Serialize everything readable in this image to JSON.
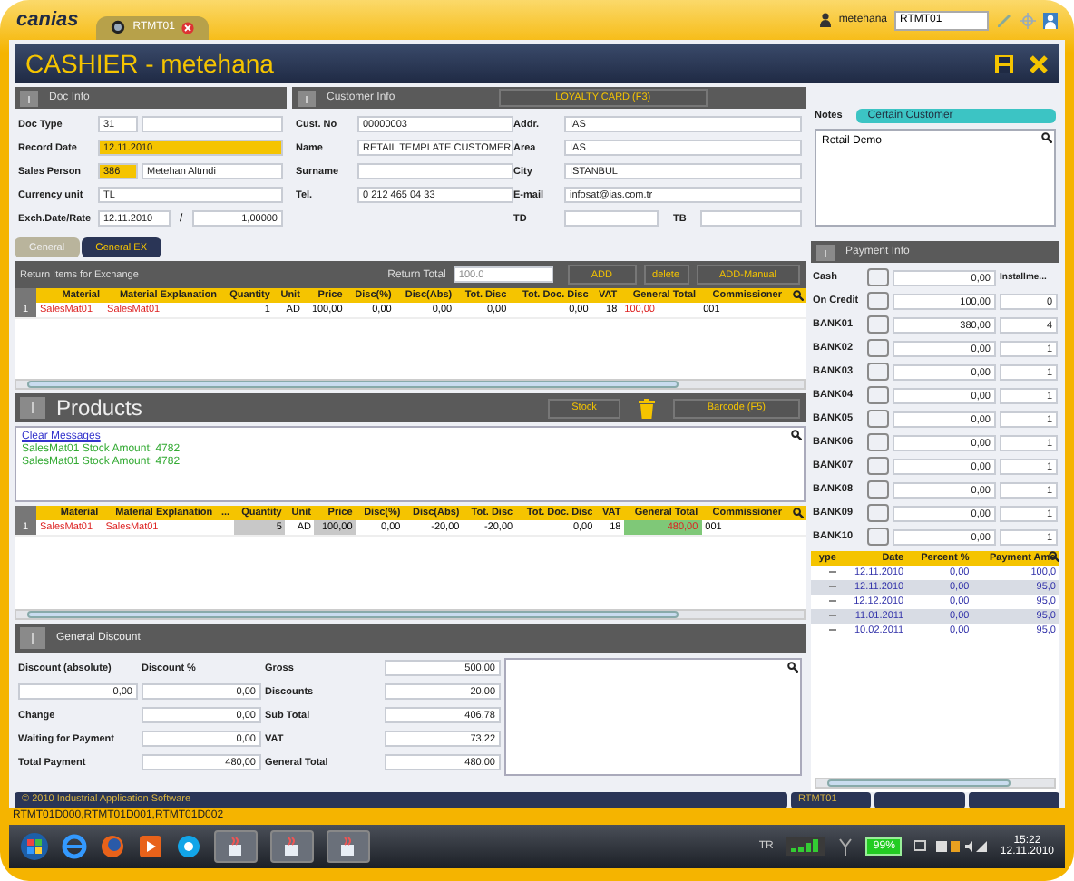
{
  "app": {
    "logo": "canias",
    "tab": {
      "label": "RTMT01"
    },
    "user": "metehana",
    "server": "RTMT01"
  },
  "window": {
    "title": "CASHIER - metehana"
  },
  "doc_info": {
    "title": "Doc Info",
    "fields": [
      {
        "label": "Doc Type",
        "inputs": [
          {
            "value": "31",
            "highlighted": false
          },
          {
            "highlighted": false
          }
        ]
      },
      {
        "label": "Record Date",
        "inputs": [
          {
            "value": "12.11.2010",
            "highlighted": true
          }
        ]
      },
      {
        "label": "Sales Person",
        "inputs": [
          {
            "value": "386",
            "highlighted": true
          },
          {
            "value": "Metehan Altındi",
            "highlighted": false
          }
        ]
      },
      {
        "label": "Currency unit",
        "inputs": [
          {
            "value": "TL",
            "highlighted": false
          }
        ]
      },
      {
        "label": "Exch.Date/Rate",
        "separator": "/",
        "inputs": [
          {
            "value": "12.11.2010",
            "highlighted": false
          },
          {
            "value": "1,00000",
            "highlighted": false
          }
        ]
      }
    ]
  },
  "customer_info": {
    "title": "Customer Info",
    "loyalty_button": "LOYALTY CARD (F3)",
    "left": [
      {
        "label": "Cust. No",
        "value": "00000003"
      },
      {
        "label": "Name",
        "value": "RETAIL TEMPLATE CUSTOMER"
      },
      {
        "label": "Surname"
      },
      {
        "label": "Tel.",
        "value": "0 212 465 04 33"
      }
    ],
    "right": [
      {
        "label": "Addr.",
        "value": "IAS"
      },
      {
        "label": "Area",
        "value": "IAS"
      },
      {
        "label": "City",
        "value": "ISTANBUL"
      },
      {
        "label": "E-mail",
        "value": "infosat@ias.com.tr"
      }
    ],
    "bottom": [
      {
        "label": "TD"
      },
      {
        "label": "TB"
      }
    ]
  },
  "notes": {
    "label": "Notes",
    "badge": "Certain Customer",
    "text": "Retail Demo"
  },
  "tabs": [
    {
      "label": "General",
      "selected": false
    },
    {
      "label": "General EX",
      "selected": true
    }
  ],
  "return_bar": {
    "title": "Return Items for Exchange",
    "total_label": "Return Total",
    "total_value": "100.0",
    "buttons": [
      "ADD",
      "delete",
      "ADD-Manual"
    ]
  },
  "return_table": {
    "columns": [
      "Material",
      "Material Explanation",
      "Quantity",
      "Unit",
      "Price",
      "Disc(%)",
      "Disc(Abs)",
      "Tot. Disc",
      "Tot. Doc. Disc",
      "VAT",
      "General Total",
      "Commissioner"
    ],
    "rows": [
      {
        "number": "1",
        "cells": [
          "SalesMat01",
          "SalesMat01",
          "1",
          "AD",
          "100,00",
          "0,00",
          "0,00",
          "0,00",
          "0,00",
          "18",
          "100,00",
          "001"
        ]
      }
    ]
  },
  "products": {
    "title": "Products",
    "stock_button": "Stock",
    "barcode_button": "Barcode (F5)"
  },
  "messages": {
    "link": "Clear Messages",
    "lines": [
      "SalesMat01 Stock Amount: 4782",
      "SalesMat01 Stock Amount: 4782"
    ]
  },
  "products_table": {
    "columns": [
      "Material",
      "Material Explanation",
      "...",
      "Quantity",
      "Unit",
      "Price",
      "Disc(%)",
      "Disc(Abs)",
      "Tot. Disc",
      "Tot. Doc. Disc",
      "VAT",
      "General Total",
      "Commissioner"
    ],
    "rows": [
      {
        "number": "1",
        "cells": [
          "SalesMat01",
          "SalesMat01",
          null,
          "5",
          "AD",
          "100,00",
          "0,00",
          "-20,00",
          "-20,00",
          "0,00",
          "18",
          "480,00",
          "001"
        ]
      }
    ]
  },
  "general_discount": {
    "title": "General Discount",
    "discount_labels": [
      "Discount (absolute)",
      "Discount %"
    ],
    "discount_values": [
      "0,00",
      "0,00"
    ],
    "left_rows": [
      {
        "label": "Change",
        "value": "0,00"
      },
      {
        "label": "Waiting for Payment",
        "value": "0,00"
      },
      {
        "label": "Total Payment",
        "value": "480,00"
      }
    ],
    "totals": [
      {
        "label": "Gross",
        "value": "500,00"
      },
      {
        "label": "Discounts",
        "value": "20,00"
      },
      {
        "label": "Sub Total",
        "value": "406,78"
      },
      {
        "label": "VAT",
        "value": "73,22"
      },
      {
        "label": "General Total",
        "value": "480,00"
      }
    ]
  },
  "payment_info": {
    "title": "Payment Info",
    "installments_heading": "Installme...",
    "methods": [
      {
        "label": "Cash",
        "amount": "0,00"
      },
      {
        "label": "On Credit",
        "amount": "100,00",
        "installments": "0"
      },
      {
        "label": "BANK01",
        "amount": "380,00",
        "installments": "4"
      },
      {
        "label": "BANK02",
        "amount": "0,00",
        "installments": "1"
      },
      {
        "label": "BANK03",
        "amount": "0,00",
        "installments": "1"
      },
      {
        "label": "BANK04",
        "amount": "0,00",
        "installments": "1"
      },
      {
        "label": "BANK05",
        "amount": "0,00",
        "installments": "1"
      },
      {
        "label": "BANK06",
        "amount": "0,00",
        "installments": "1"
      },
      {
        "label": "BANK07",
        "amount": "0,00",
        "installments": "1"
      },
      {
        "label": "BANK08",
        "amount": "0,00",
        "installments": "1"
      },
      {
        "label": "BANK09",
        "amount": "0,00",
        "installments": "1"
      },
      {
        "label": "BANK10",
        "amount": "0,00",
        "installments": "1"
      }
    ]
  },
  "installment_plan": {
    "columns": [
      "ype",
      "Date",
      "Percent %",
      "Payment Amo"
    ],
    "rows": [
      {
        "date": "12.11.2010",
        "percent": "0,00",
        "amount": "100,0"
      },
      {
        "date": "12.11.2010",
        "percent": "0,00",
        "amount": "95,0"
      },
      {
        "date": "12.12.2010",
        "percent": "0,00",
        "amount": "95,0"
      },
      {
        "date": "11.01.2011",
        "percent": "0,00",
        "amount": "95,0"
      },
      {
        "date": "10.02.2011",
        "percent": "0,00",
        "amount": "95,0"
      }
    ]
  },
  "footer": {
    "copyright": "© 2010 Industrial Application Software",
    "station": "RTMT01"
  },
  "status_line": "RTMT01D000,RTMT01D001,RTMT01D002",
  "taskbar": {
    "language": "TR",
    "battery": "99%",
    "time": "15:22",
    "date": "12.11.2010"
  }
}
